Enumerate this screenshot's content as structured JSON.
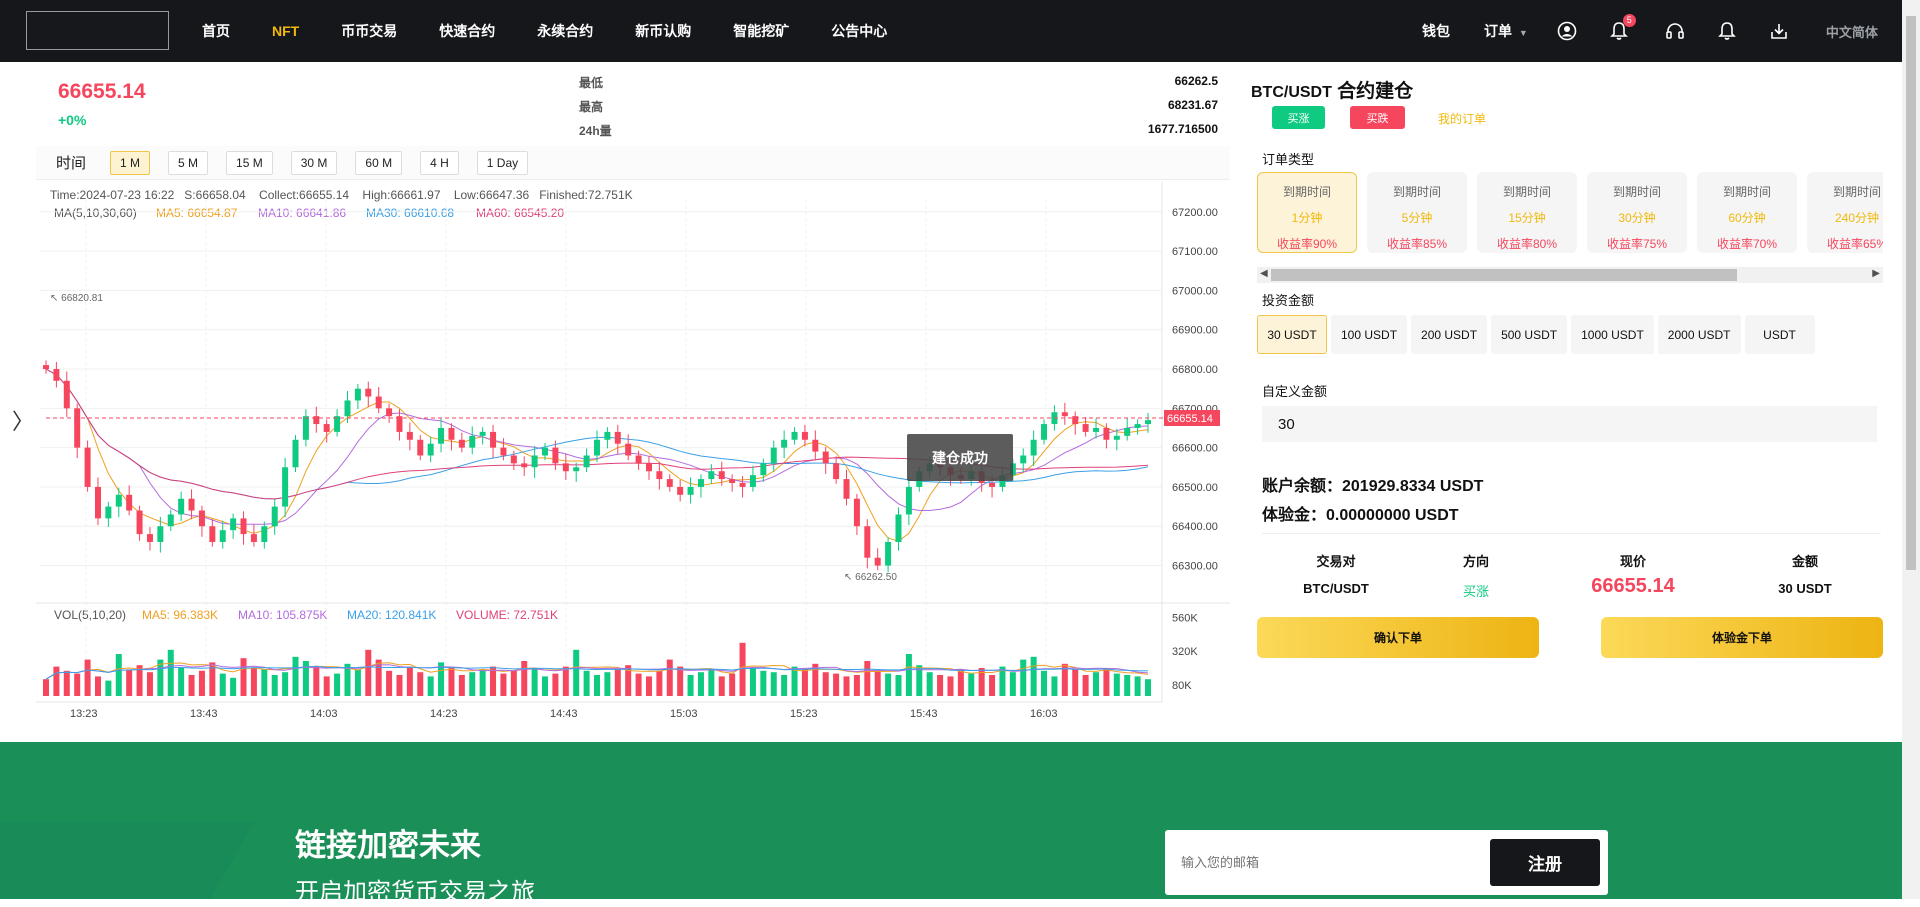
{
  "nav": {
    "items": [
      "首页",
      "NFT",
      "币币交易",
      "快速合约",
      "永续合约",
      "新币认购",
      "智能挖矿",
      "公告中心"
    ],
    "active_index": 1,
    "wallet": "钱包",
    "orders": "订单",
    "notification_count": "5",
    "language": "中文简体"
  },
  "ticker": {
    "price": "66655.14",
    "change": "+0%",
    "low_label": "最低",
    "low": "66262.5",
    "high_label": "最高",
    "high": "68231.67",
    "vol_label": "24h量",
    "vol": "1677.716500"
  },
  "periods": {
    "time_label": "时间",
    "items": [
      "1 M",
      "5 M",
      "15 M",
      "30 M",
      "60 M",
      "4 H",
      "1 Day"
    ],
    "active_index": 0
  },
  "chart_info": {
    "line1": "Time:2024-07-23 16:22   S:66658.04    Collect:66655.14    High:66661.97    Low:66647.36   Finished:72.751K",
    "ma_title": "MA(5,10,30,60)",
    "ma5": "MA5: 66654.87",
    "ma10": "MA10: 66641.86",
    "ma30": "MA30: 66610.68",
    "ma60": "MA60: 66545.20",
    "vol_title": "VOL(5,10,20)",
    "vma5": "MA5: 96.383K",
    "vma10": "MA10: 105.875K",
    "vma20": "MA20: 120.841K",
    "volume": "VOLUME: 72.751K",
    "max_mark": "66820.81",
    "min_mark": "66262.50",
    "last_price_tag": "66655.14",
    "toast": "建仓成功",
    "colors": {
      "up": "#0ecb81",
      "down": "#f6465d",
      "ma5": "#f0a020",
      "ma10": "#b36be0",
      "ma30": "#3aa0e8",
      "ma60": "#e0407a"
    }
  },
  "chart_data": {
    "type": "candlestick",
    "x_tick_labels": [
      "13:23",
      "13:43",
      "14:03",
      "14:23",
      "14:43",
      "15:03",
      "15:23",
      "15:43",
      "16:03"
    ],
    "y_tick_labels": [
      "67200.00",
      "67100.00",
      "67000.00",
      "66900.00",
      "66800.00",
      "66700.00",
      "66600.00",
      "66500.00",
      "66400.00",
      "66300.00"
    ],
    "ylim": [
      66220,
      67230
    ],
    "vol_tick_labels": [
      "560K",
      "320K",
      "80K"
    ],
    "vol_ylim": [
      0,
      600
    ],
    "price_path": [
      66800,
      66770,
      66700,
      66600,
      66500,
      66420,
      66450,
      66480,
      66440,
      66380,
      66360,
      66400,
      66430,
      66470,
      66440,
      66400,
      66360,
      66390,
      66420,
      66380,
      66360,
      66400,
      66450,
      66550,
      66620,
      66680,
      66660,
      66640,
      66680,
      66720,
      66750,
      66730,
      66700,
      66680,
      66640,
      66620,
      66580,
      66610,
      66650,
      66620,
      66600,
      66630,
      66640,
      66600,
      66580,
      66560,
      66550,
      66580,
      66600,
      66560,
      66540,
      66550,
      66580,
      66620,
      66640,
      66610,
      66580,
      66560,
      66540,
      66520,
      66500,
      66480,
      66500,
      66520,
      66540,
      66520,
      66510,
      66500,
      66530,
      66560,
      66600,
      66620,
      66640,
      66620,
      66590,
      66560,
      66520,
      66470,
      66400,
      66320,
      66300,
      66360,
      66430,
      66500,
      66540,
      66560,
      66550,
      66530,
      66520,
      66540,
      66510,
      66500,
      66530,
      66560,
      66580,
      66620,
      66660,
      66690,
      66680,
      66660,
      66640,
      66650,
      66620,
      66630,
      66650,
      66660,
      66670
    ],
    "volume_path": [
      120,
      210,
      180,
      160,
      260,
      140,
      110,
      300,
      190,
      220,
      170,
      260,
      330,
      200,
      150,
      180,
      240,
      160,
      130,
      270,
      200,
      190,
      150,
      170,
      280,
      250,
      210,
      140,
      160,
      230,
      190,
      330,
      260,
      180,
      150,
      210,
      170,
      140,
      240,
      200,
      150,
      170,
      190,
      210,
      160,
      180,
      250,
      200,
      140,
      160,
      210,
      330,
      180,
      150,
      170,
      190,
      220,
      160,
      140,
      180,
      260,
      210,
      150,
      170,
      190,
      140,
      160,
      380,
      200,
      180,
      170,
      150,
      210,
      190,
      230,
      170,
      160,
      140,
      150,
      250,
      180,
      160,
      150,
      300,
      220,
      170,
      150,
      140,
      190,
      160,
      200,
      150,
      210,
      170,
      260,
      280,
      180,
      140,
      230,
      190,
      150,
      170,
      200,
      160,
      150,
      140,
      120
    ]
  },
  "panel": {
    "pair": "BTC/USDT",
    "title": "合约建仓",
    "rise": "买涨",
    "fall": "买跌",
    "my_orders": "我的订单",
    "order_type_label": "订单类型",
    "order_types": [
      {
        "l1": "到期时间",
        "l2": "1分钟",
        "l3": "收益率90%"
      },
      {
        "l1": "到期时间",
        "l2": "5分钟",
        "l3": "收益率85%"
      },
      {
        "l1": "到期时间",
        "l2": "15分钟",
        "l3": "收益率80%"
      },
      {
        "l1": "到期时间",
        "l2": "30分钟",
        "l3": "收益率75%"
      },
      {
        "l1": "到期时间",
        "l2": "60分钟",
        "l3": "收益率70%"
      },
      {
        "l1": "到期时间",
        "l2": "240分钟",
        "l3": "收益率65%"
      }
    ],
    "order_type_active": 0,
    "amount_label": "投资金额",
    "amounts": [
      "30 USDT",
      "100 USDT",
      "200 USDT",
      "500 USDT",
      "1000 USDT",
      "2000 USDT",
      "USDT"
    ],
    "amount_active": 0,
    "custom_label": "自定义金额",
    "custom_value": "30",
    "balance": "账户余额：201929.8334 USDT",
    "trial": "体验金：0.00000000 USDT",
    "info": {
      "pair_h": "交易对",
      "pair_v": "BTC/USDT",
      "dir_h": "方向",
      "dir_v": "买涨",
      "price_h": "现价",
      "price_v": "66655.14",
      "amount_h": "金额",
      "amount_v": "30 USDT"
    },
    "confirm": "确认下单",
    "trial_order": "体验金下单"
  },
  "footer": {
    "slogan": "链接加密未来",
    "sub": "开启加密货币交易之旅",
    "email_placeholder": "输入您的邮箱",
    "signup": "注册"
  }
}
